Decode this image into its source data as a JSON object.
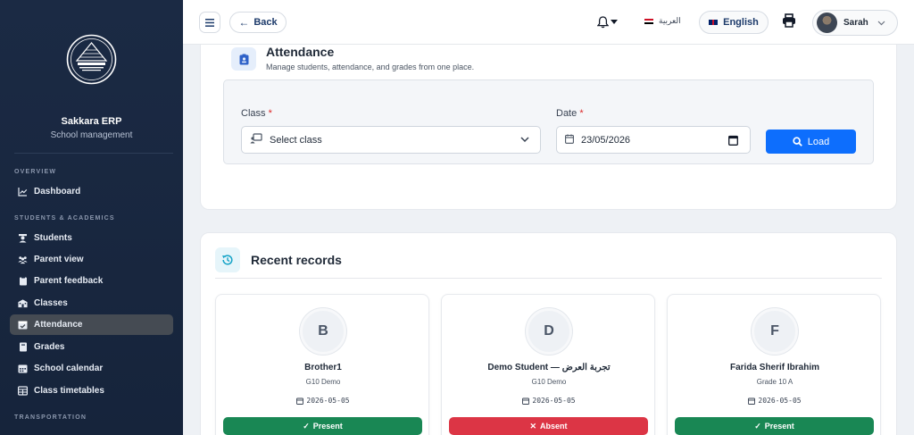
{
  "sidebar": {
    "brand_name": "Sakkara ERP",
    "brand_sub": "School management",
    "sections": {
      "overview": "OVERVIEW",
      "students": "STUDENTS & ACADEMICS",
      "transport": "TRANSPORTATION"
    },
    "items": {
      "dashboard": "Dashboard",
      "students": "Students",
      "parent_view": "Parent view",
      "parent_feedback": "Parent feedback",
      "classes": "Classes",
      "attendance": "Attendance",
      "grades": "Grades",
      "school_calendar": "School calendar",
      "class_timetables": "Class timetables"
    },
    "active_item": "Attendance"
  },
  "topbar": {
    "back_label": "Back",
    "lang_ar": "العربية",
    "lang_en": "English",
    "user_name": "Sarah"
  },
  "attendance": {
    "title": "Attendance",
    "subtitle": "Manage students, attendance, and grades from one place.",
    "class_label": "Class",
    "class_value": "Select class",
    "date_label": "Date",
    "date_value": "23/05/2026",
    "required_mark": "*",
    "load_label": "Load"
  },
  "recent": {
    "title": "Recent records",
    "cards": [
      {
        "initial": "B",
        "name": "Brother1",
        "class": "G10 Demo",
        "date": "2026-05-05",
        "status": "Present",
        "status_color": "#198754"
      },
      {
        "initial": "D",
        "name": "Demo Student — تجربة العرض",
        "class": "G10 Demo",
        "date": "2026-05-05",
        "status": "Absent",
        "status_color": "#dc3545"
      },
      {
        "initial": "F",
        "name": "Farida Sherif Ibrahim",
        "class": "Grade 10 A",
        "date": "2026-05-05",
        "status": "Present",
        "status_color": "#198754"
      }
    ]
  },
  "colors": {
    "sidebar_bg": "#1b2a44",
    "accent": "#0d6efd",
    "present": "#198754",
    "absent": "#dc3545"
  }
}
